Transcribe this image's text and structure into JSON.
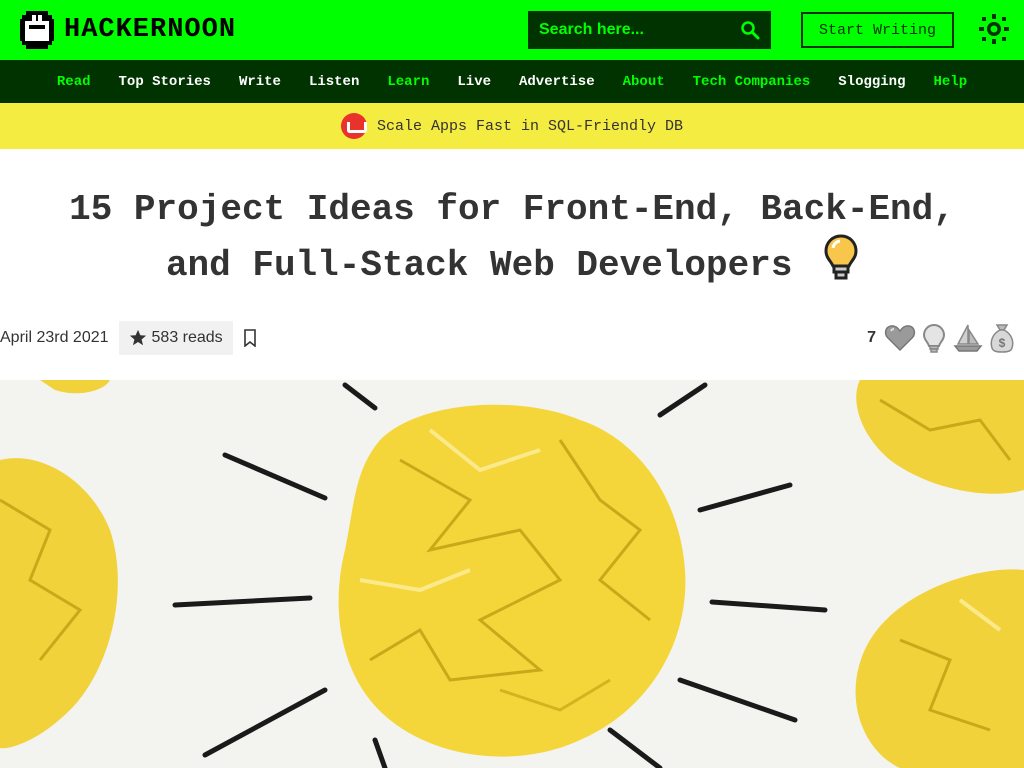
{
  "header": {
    "logo_text": "HACKERNOON",
    "search_placeholder": "Search here...",
    "start_writing_label": "Start Writing"
  },
  "nav": {
    "items": [
      {
        "label": "Read",
        "color": "#00ff00"
      },
      {
        "label": "Top Stories",
        "color": "#ffffff"
      },
      {
        "label": "Write",
        "color": "#ffffff"
      },
      {
        "label": "Listen",
        "color": "#ffffff"
      },
      {
        "label": "Learn",
        "color": "#00ff00"
      },
      {
        "label": "Live",
        "color": "#ffffff"
      },
      {
        "label": "Advertise",
        "color": "#ffffff"
      },
      {
        "label": "About",
        "color": "#00ff00"
      },
      {
        "label": "Tech Companies",
        "color": "#00ff00"
      },
      {
        "label": "Slogging",
        "color": "#ffffff"
      },
      {
        "label": "Help",
        "color": "#00ff00"
      }
    ]
  },
  "banner": {
    "text": "Scale Apps Fast in SQL-Friendly DB"
  },
  "article": {
    "title_line1": "15 Project Ideas for Front-End, Back-End,",
    "title_line2": "and Full-Stack Web Developers",
    "date": "April 23rd 2021",
    "reads": "583 reads",
    "reaction_count": "7"
  },
  "icons": {
    "logo": "hackernoon-logo-icon",
    "search": "search-icon",
    "theme": "sun-icon",
    "banner": "cockroach-db-icon",
    "title": "lightbulb-icon",
    "reads": "star-icon",
    "bookmark": "bookmark-icon",
    "reactions": [
      "heart-icon",
      "lightbulb-icon",
      "boat-icon",
      "money-bag-icon"
    ]
  },
  "colors": {
    "brand_green": "#00ff00",
    "dark_green": "#003300",
    "banner_yellow": "#f5ec42"
  }
}
